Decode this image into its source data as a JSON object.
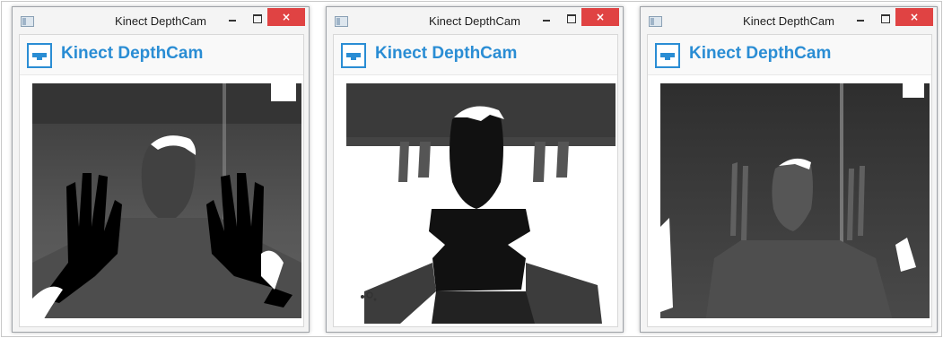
{
  "windows": [
    {
      "title": "Kinect DepthCam",
      "header_title": "Kinect DepthCam",
      "close_glyph": "×",
      "depth_view": "silhouette-hands-black"
    },
    {
      "title": "Kinect DepthCam",
      "header_title": "Kinect DepthCam",
      "close_glyph": "×",
      "depth_view": "inverted-white-background"
    },
    {
      "title": "Kinect DepthCam",
      "header_title": "Kinect DepthCam",
      "close_glyph": "×",
      "depth_view": "gray-depth-gradient"
    }
  ],
  "icons": {
    "app": "window-app-icon",
    "header": "kinect-sensor-icon",
    "minimize": "minimize-icon",
    "maximize": "maximize-icon",
    "close": "close-icon"
  },
  "colors": {
    "accent": "#2a8dd4",
    "close_button": "#e04343",
    "titlebar": "#f4f4f4"
  }
}
